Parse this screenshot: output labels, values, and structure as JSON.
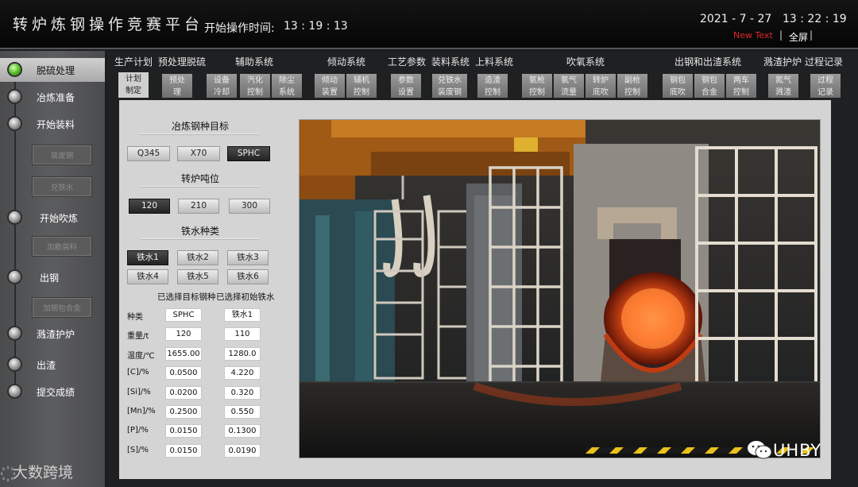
{
  "header": {
    "title": "转炉炼钢操作竞赛平台",
    "op_time_label": "开始操作时间:",
    "op_time": "13 : 19 : 13",
    "date": "2021 - 7 - 27",
    "clock": "13 : 22 : 19",
    "new_text": "New Text",
    "sep": "|",
    "fullscreen": "全屏"
  },
  "sidebar": {
    "steps": [
      {
        "label": "脱硫处理"
      },
      {
        "label": "冶炼准备"
      },
      {
        "label": "开始装料"
      },
      {
        "label": "开始吹炼"
      },
      {
        "label": "出钢"
      },
      {
        "label": "溅渣护炉"
      },
      {
        "label": "出渣"
      },
      {
        "label": "提交成绩"
      }
    ],
    "substeps": [
      "装废钢",
      "兑铁水",
      "加散装料",
      "加钢包合金"
    ]
  },
  "groups": [
    "生产计划",
    "预处理脱硫",
    "辅助系统",
    "倾动系统",
    "工艺参数",
    "装料系统",
    "上料系统",
    "吹氧系统",
    "出钢和出渣系统",
    "溅渣护炉",
    "过程记录"
  ],
  "tabs": [
    [
      "计划",
      "制定"
    ],
    [
      "预处",
      "理"
    ],
    [
      "设备",
      "冷却"
    ],
    [
      "汽化",
      "控制"
    ],
    [
      "除尘",
      "系统"
    ],
    [
      "倾动",
      "装置"
    ],
    [
      "辅机",
      "控制"
    ],
    [
      "参数",
      "设置"
    ],
    [
      "兑铁水",
      "装废钢"
    ],
    [
      "造渣",
      "控制"
    ],
    [
      "氧枪",
      "控制"
    ],
    [
      "氧气",
      "流量"
    ],
    [
      "转炉",
      "底吹"
    ],
    [
      "副枪",
      "控制"
    ],
    [
      "钢包",
      "底吹"
    ],
    [
      "钢包",
      "合金"
    ],
    [
      "两车",
      "控制"
    ],
    [
      "氮气",
      "溅渣"
    ],
    [
      "过程",
      "记录"
    ]
  ],
  "panel": {
    "steel_title": "冶炼钢种目标",
    "steel_options": [
      "Q345",
      "X70",
      "SPHC"
    ],
    "steel_selected": "SPHC",
    "tonnage_title": "转炉吨位",
    "tonnage_options": [
      "120",
      "210",
      "300"
    ],
    "tonnage_selected": "120",
    "iron_title": "铁水种类",
    "iron_options": [
      "铁水1",
      "铁水2",
      "铁水3",
      "铁水4",
      "铁水5",
      "铁水6"
    ],
    "iron_selected": "铁水1",
    "col_target": "已选择目标钢种",
    "col_iron": "已选择初始铁水",
    "rows": [
      {
        "label": "种类",
        "target": "SPHC",
        "iron": "铁水1"
      },
      {
        "label": "重量/t",
        "target": "120",
        "iron": "110"
      },
      {
        "label": "温度/℃",
        "target": "1655.00",
        "iron": "1280.0"
      },
      {
        "label": "[C]/%",
        "target": "0.0500",
        "iron": "4.220"
      },
      {
        "label": "[Si]/%",
        "target": "0.0200",
        "iron": "0.320"
      },
      {
        "label": "[Mn]/%",
        "target": "0.2500",
        "iron": "0.550"
      },
      {
        "label": "[P]/%",
        "target": "0.0150",
        "iron": "0.1300"
      },
      {
        "label": "[S]/%",
        "target": "0.0150",
        "iron": "0.0190"
      }
    ]
  },
  "watermarks": {
    "left": "大数跨境",
    "right": "UHBY"
  },
  "colors": {
    "accent_red": "#e0242a",
    "active_dot": "#4fb81e",
    "selected_option": "#2e2e2e"
  }
}
